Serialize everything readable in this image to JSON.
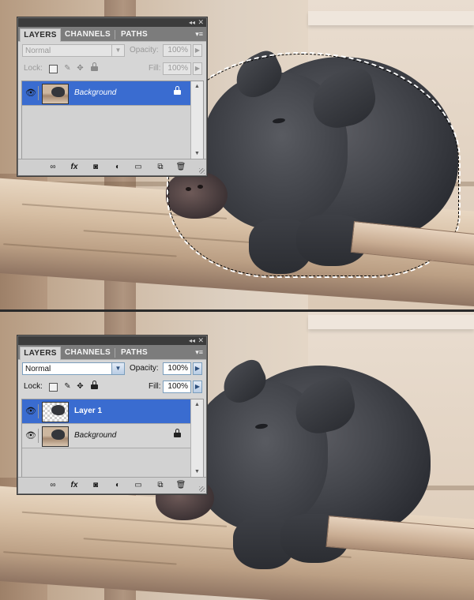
{
  "panels": [
    {
      "state": "disabled",
      "tabs": [
        "LAYERS",
        "CHANNELS",
        "PATHS"
      ],
      "blend_mode": "Normal",
      "opacity_label": "Opacity:",
      "opacity_value": "100%",
      "lock_label": "Lock:",
      "fill_label": "Fill:",
      "fill_value": "100%",
      "layers": [
        {
          "name": "Background",
          "selected": true,
          "visible": true,
          "locked": true
        }
      ]
    },
    {
      "state": "enabled",
      "tabs": [
        "LAYERS",
        "CHANNELS",
        "PATHS"
      ],
      "blend_mode": "Normal",
      "opacity_label": "Opacity:",
      "opacity_value": "100%",
      "lock_label": "Lock:",
      "fill_label": "Fill:",
      "fill_value": "100%",
      "layers": [
        {
          "name": "Layer 1",
          "selected": true,
          "visible": true,
          "locked": false
        },
        {
          "name": "Background",
          "selected": false,
          "visible": true,
          "locked": true
        }
      ]
    }
  ],
  "glyphs": {
    "collapse": "◂◂",
    "close": "✕",
    "panel_menu": "▾≡",
    "dropdown_arrow": "▼",
    "num_arrow": "▶",
    "eye": "👁",
    "lock_transparent": "▦",
    "lock_paint": "✎",
    "lock_move": "✥",
    "footer_link": "∞",
    "footer_fx": "fx",
    "footer_mask": "◙",
    "footer_adjust": "◐",
    "footer_group": "▭",
    "footer_new": "⧉",
    "footer_delete": "🗑",
    "scroll_up": "▲",
    "scroll_down": "▼"
  },
  "colors": {
    "selection": "#3a6cd0",
    "panel_bg": "#d6d6d6",
    "titlebar": "#3c3c3c",
    "tab_strip": "#7c7c7c"
  }
}
